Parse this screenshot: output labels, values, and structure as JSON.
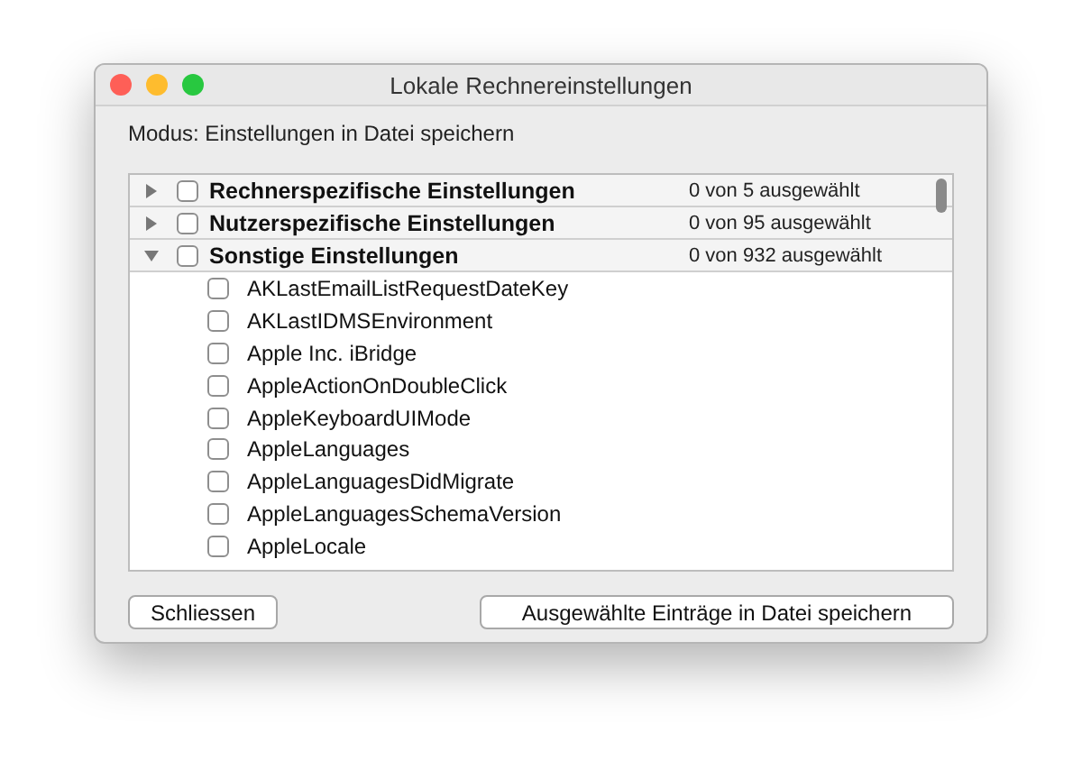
{
  "window": {
    "title": "Lokale Rechnereinstellungen"
  },
  "mode_label": "Modus: Einstellungen in Datei speichern",
  "tree": [
    {
      "label": "Rechnerspezifische Einstellungen",
      "count": "0 von 5 ausgewählt",
      "expanded": false,
      "checked": false
    },
    {
      "label": "Nutzerspezifische Einstellungen",
      "count": "0 von 95 ausgewählt",
      "expanded": false,
      "checked": false
    },
    {
      "label": "Sonstige Einstellungen",
      "count": "0 von 932 ausgewählt",
      "expanded": true,
      "checked": false,
      "children": [
        {
          "label": "AKLastEmailListRequestDateKey",
          "checked": false
        },
        {
          "label": "AKLastIDMSEnvironment",
          "checked": false
        },
        {
          "label": "Apple Inc. iBridge",
          "checked": false
        },
        {
          "label": "AppleActionOnDoubleClick",
          "checked": false
        },
        {
          "label": "AppleKeyboardUIMode",
          "checked": false
        },
        {
          "label": "AppleLanguages",
          "checked": false
        },
        {
          "label": "AppleLanguagesDidMigrate",
          "checked": false
        },
        {
          "label": "AppleLanguagesSchemaVersion",
          "checked": false
        },
        {
          "label": "AppleLocale",
          "checked": false
        }
      ]
    }
  ],
  "buttons": [
    "Schliessen",
    "Ausgewählte Einträge in Datei speichern"
  ]
}
